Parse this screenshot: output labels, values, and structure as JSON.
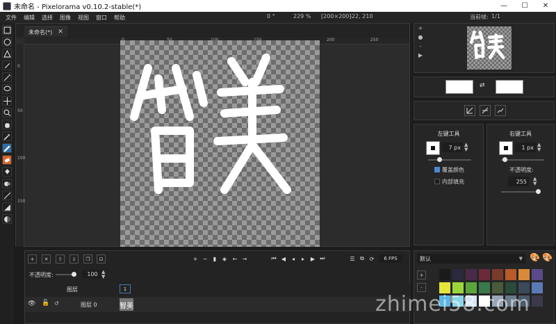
{
  "window": {
    "title": "未命名 - Pixelorama v0.10.2-stable(*)"
  },
  "menu": {
    "items": [
      "文件",
      "编辑",
      "选择",
      "图像",
      "视图",
      "窗口",
      "帮助"
    ],
    "rotation": "0 °",
    "zoom": "229 %",
    "canvas_size": "[200×200]",
    "cursor_pos": "-22, 210",
    "current_frame_label": "当前帧:",
    "current_frame_value": "1/1"
  },
  "canvas": {
    "tab_label": "未命名(*)",
    "ruler_h": [
      "0",
      "50",
      "100",
      "150",
      "200",
      "250"
    ],
    "ruler_v": [
      "0",
      "50",
      "100",
      "150"
    ],
    "drawing_text": "智美"
  },
  "preview": {
    "side_labels": [
      "+",
      "-"
    ],
    "thumb_text": "智美"
  },
  "left_tool": {
    "title": "左键工具",
    "size": "7 px",
    "option1": "覆盖颜色",
    "option2": "内部填充"
  },
  "right_tool": {
    "title": "右键工具",
    "size": "1 px",
    "opacity_label": "不透明度:",
    "opacity_value": "255"
  },
  "timeline": {
    "fps": "6 FPS",
    "opacity_label": "不透明度:",
    "opacity_value": "100",
    "layers_header": "图层",
    "frame_number": "1",
    "layer_name": "图层 0"
  },
  "palette": {
    "name": "默认",
    "colors": [
      "#1a1a1a",
      "#2a2a3c",
      "#4a2a4a",
      "#6a2a3a",
      "#7a3a2a",
      "#b85a2a",
      "#d88a3a",
      "#5a4a8a",
      "#e6e63a",
      "#9ad63a",
      "#5aa63a",
      "#3a7a4a",
      "#4a5a3a",
      "#2a4a3a",
      "#3a4a5a",
      "#5a7ab6",
      "#5ab6e6",
      "#8ad6e6",
      "#d6e6f6",
      "#ffffff",
      "#9aa6b6",
      "#6a7a8a",
      "#4a5a6a",
      "#3a3a4a"
    ],
    "remove_label": "-"
  },
  "watermark": "zhimei58.com"
}
